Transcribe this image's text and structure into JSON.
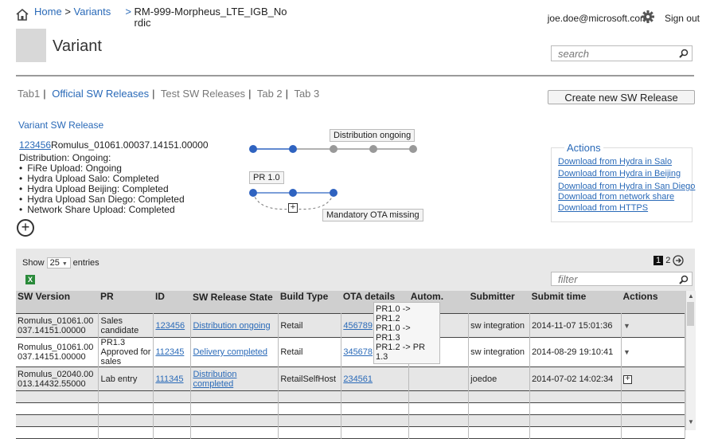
{
  "header": {
    "breadcrumb": {
      "home": "Home",
      "sep1": ">",
      "variants": "Variants",
      "sep2": ">",
      "current": "RM-999-Morpheus_LTE_IGB_Nordic"
    },
    "user_email": "joe.doe@microsoft.com",
    "sign_out": "Sign out",
    "page_title": "Variant",
    "search_placeholder": "search"
  },
  "tabs": [
    "Tab1",
    "Official SW Releases",
    "Test SW Releases",
    "Tab 2",
    "Tab 3"
  ],
  "active_tab": "Official SW Releases",
  "create_button": "Create new SW Release",
  "variant_sw_release": {
    "title": "Variant SW Release",
    "id": "123456",
    "name": "Romulus_01061.00037.14151.00000",
    "distribution_label": "Distribution: Ongoing:",
    "items": [
      "FiRe Upload: Ongoing",
      "Hydra Upload Salo: Completed",
      "Hydra Upload Beijing: Completed",
      "Hydra Upload San Diego: Completed",
      "Network Share Upload: Completed"
    ]
  },
  "flow": {
    "tooltip_distribution": "Distribution ongoing",
    "tooltip_pr": "PR 1.0",
    "tooltip_ota": "Mandatory OTA missing",
    "plus": "+"
  },
  "actions_box": {
    "title": "Actions",
    "links": [
      "Download from Hydra in Salo",
      "Download from Hydra in Beijing",
      "Download from Hydra in San Diego",
      "Download from network share",
      "Download from HTTPS"
    ]
  },
  "add_icon": "+",
  "table": {
    "show_label": "Show",
    "entries_value": "25",
    "entries_label": "entries",
    "filter_placeholder": "filter",
    "pages": [
      "1",
      "2"
    ],
    "columns": [
      "SW Version",
      "PR",
      "ID",
      "SW Release State",
      "Build Type",
      "OTA details",
      "Autom.",
      "Submitter",
      "Submit time",
      "Actions"
    ],
    "rows": [
      {
        "sw_version": "Romulus_01061.00 037.14151.00000",
        "pr": "Sales candidate",
        "id": "123456",
        "state": "Distribution ongoing",
        "build": "Retail",
        "ota": "456789",
        "autom": "",
        "submitter": "sw integration",
        "time": "2014-11-07 15:01:36"
      },
      {
        "sw_version": "Romulus_01061.00 037.14151.00000",
        "pr": "PR1.3 Approved for sales",
        "id": "112345",
        "state": "Delivery completed",
        "build": "Retail",
        "ota": "345678",
        "autom": "",
        "submitter": "sw integration",
        "time": "2014-08-29 19:10:41"
      },
      {
        "sw_version": "Romulus_02040.00 013.14432.55000",
        "pr": "Lab entry",
        "id": "111345",
        "state": "Distribution completed",
        "build": "RetailSelfHost",
        "ota": "234561",
        "autom": "",
        "submitter": "joedoe",
        "time": "2014-07-02 14:02:34"
      }
    ],
    "ota_popup": [
      "PR1.0 ->",
      "PR1.2",
      "PR1.0 ->",
      "PR1.3",
      "PR1.2 -> PR",
      "1.3"
    ]
  }
}
